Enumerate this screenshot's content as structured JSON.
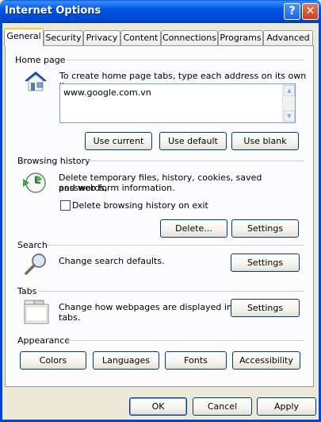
{
  "window": {
    "title": "Internet Options",
    "help_glyph": "?",
    "close_glyph": "✕"
  },
  "tabs": [
    {
      "label": "General",
      "active": true
    },
    {
      "label": "Security"
    },
    {
      "label": "Privacy"
    },
    {
      "label": "Content"
    },
    {
      "label": "Connections"
    },
    {
      "label": "Programs"
    },
    {
      "label": "Advanced"
    }
  ],
  "home_page": {
    "group_label": "Home page",
    "description": "To create home page tabs, type each address on its own line.",
    "value": "www.google.com.vn",
    "buttons": {
      "use_current": "Use current",
      "use_default": "Use default",
      "use_blank": "Use blank"
    },
    "icon": "house-icon"
  },
  "browsing_history": {
    "group_label": "Browsing history",
    "description_line1": "Delete temporary files, history, cookies, saved passwords,",
    "description_line2": "and web form information.",
    "checkbox_label": "Delete browsing history on exit",
    "checkbox_checked": false,
    "buttons": {
      "delete": "Delete...",
      "settings": "Settings"
    },
    "icon": "history-clock-icon"
  },
  "search": {
    "group_label": "Search",
    "description": "Change search defaults.",
    "settings_label": "Settings",
    "icon": "magnifier-icon"
  },
  "tabs_section": {
    "group_label": "Tabs",
    "description_line1": "Change how webpages are displayed in",
    "description_line2": "tabs.",
    "settings_label": "Settings",
    "icon": "tabs-window-icon"
  },
  "appearance": {
    "group_label": "Appearance",
    "buttons": {
      "colors": "Colors",
      "languages": "Languages",
      "fonts": "Fonts",
      "accessibility": "Accessibility"
    }
  },
  "footer": {
    "ok": "OK",
    "cancel": "Cancel",
    "apply": "Apply"
  },
  "colors": {
    "titlebar": "#0054e3",
    "dialog_bg": "#ece9d8",
    "panel_bg": "#fcfcfe",
    "tab_highlight": "#ffc83c",
    "button_border": "#003c74"
  }
}
